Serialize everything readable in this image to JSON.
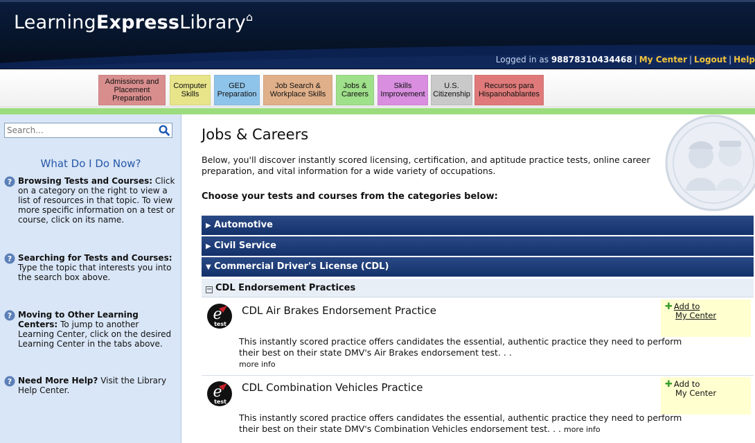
{
  "header": {
    "brand_light_1": "Learning",
    "brand_bold": "Express",
    "brand_light_2": "Library",
    "login_prefix": "Logged in as",
    "user_id": "98878310434468",
    "links": [
      "My Center",
      "Logout",
      "Help"
    ]
  },
  "tabs": [
    {
      "label": "Admissions and Placement Preparation",
      "color": "#d98e8e"
    },
    {
      "label": "Computer Skills",
      "color": "#e8e48a"
    },
    {
      "label": "GED Preparation",
      "color": "#8fc4ea"
    },
    {
      "label": "Job Search & Workplace Skills",
      "color": "#e0b08a"
    },
    {
      "label": "Jobs & Careers",
      "color": "#9fe08a"
    },
    {
      "label": "Skills Improvement",
      "color": "#d98ee0"
    },
    {
      "label": "U.S. Citizenship",
      "color": "#c9c9c9"
    },
    {
      "label": "Recursos para Hispanohablantes",
      "color": "#e07a7a"
    }
  ],
  "sidebar": {
    "search_placeholder": "Search...",
    "heading": "What Do I Do Now?",
    "help": [
      {
        "title": "Browsing Tests and Courses:",
        "text": "Click on a category on the right to view a list of resources in that topic. To view more specific information on a test or course, click on its name."
      },
      {
        "title": "Searching for Tests and Courses:",
        "text": "Type the topic that interests you into the search box above."
      },
      {
        "title": "Moving to Other Learning Centers:",
        "text": "To jump to another Learning Center, click on the desired Learning Center in the tabs above."
      },
      {
        "title": "Need More Help?",
        "text": "Visit the Library Help Center."
      }
    ]
  },
  "main": {
    "title": "Jobs & Careers",
    "intro": "Below, you'll discover instantly scored licensing, certification, and aptitude practice tests, online career preparation, and vital information for a wide variety of occupations.",
    "choose": "Choose your tests and courses from the categories below:",
    "categories": [
      {
        "label": "Automotive",
        "expanded": false
      },
      {
        "label": "Civil Service",
        "expanded": false
      },
      {
        "label": "Commercial Driver's License (CDL)",
        "expanded": true
      }
    ],
    "subcategory": "CDL Endorsement Practices",
    "items": [
      {
        "title": "CDL Air Brakes Endorsement Practice",
        "desc": "This instantly scored practice offers candidates the essential, authentic practice they need to perform their best on their state DMV's Air Brakes endorsement test. . .",
        "more": "more info",
        "add_1": "Add to",
        "add_2": "My Center"
      },
      {
        "title": "CDL Combination Vehicles Practice",
        "desc": "This instantly scored practice offers candidates the essential, authentic practice they need to perform their best on their state DMV's Combination Vehicles endorsement test. . .",
        "more": "more info",
        "add_1": "Add to",
        "add_2": "My Center"
      }
    ]
  }
}
